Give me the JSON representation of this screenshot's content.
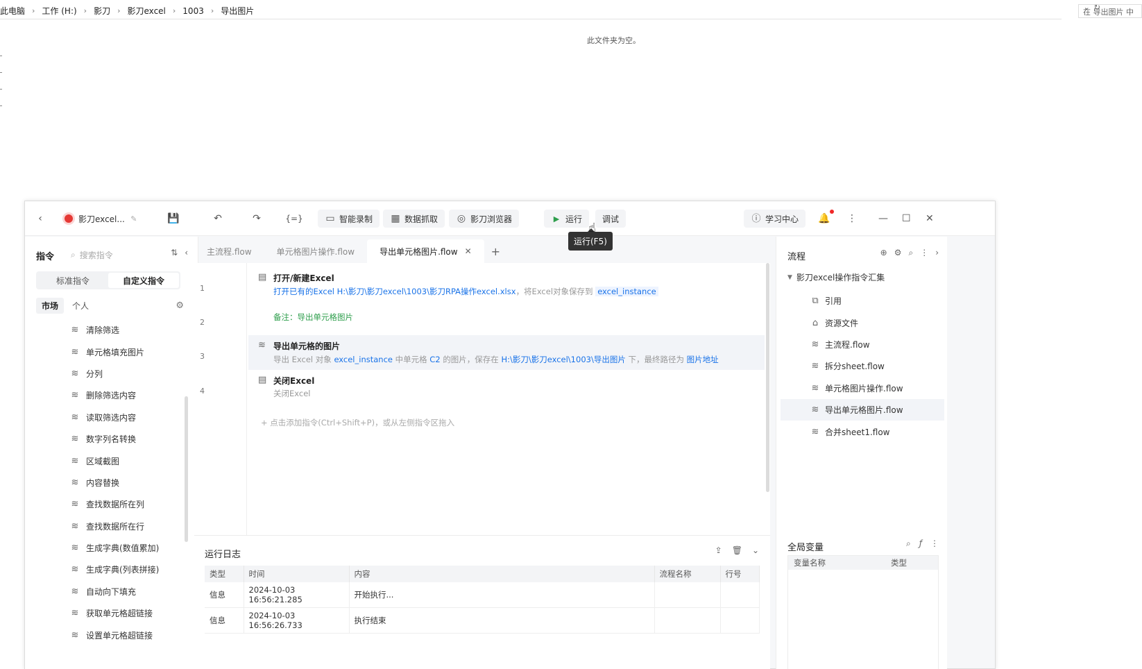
{
  "explorer": {
    "breadcrumb": [
      "此电脑",
      "工作 (H:)",
      "影刀",
      "影刀excel",
      "1003",
      "导出图片"
    ],
    "search_placeholder": "在 导出图片 中",
    "empty_message": "此文件夹为空。"
  },
  "app": {
    "title": "影刀excel...",
    "toolbar": {
      "record": "智能录制",
      "capture": "数据抓取",
      "browser": "影刀浏览器",
      "run": "运行",
      "debug": "调试",
      "learn": "学习中心",
      "run_tooltip": "运行(F5)"
    },
    "left": {
      "title": "指令",
      "search_placeholder": "搜索指令",
      "seg_standard": "标准指令",
      "seg_custom": "自定义指令",
      "market": "市场",
      "personal": "个人",
      "commands": [
        "清除筛选",
        "单元格填充图片",
        "分列",
        "删除筛选内容",
        "读取筛选内容",
        "数字列名转换",
        "区域截图",
        "内容替换",
        "查找数据所在列",
        "查找数据所在行",
        "生成字典(数值累加)",
        "生成字典(列表拼接)",
        "自动向下填充",
        "获取单元格超链接",
        "设置单元格超链接"
      ]
    },
    "tabs": [
      "主流程.flow",
      "单元格图片操作.flow",
      "导出单元格图片.flow"
    ],
    "steps": {
      "s1": {
        "num": "1",
        "title": "打开/新建Excel",
        "desc_a": "打开已有的Excel H:\\影刀\\影刀excel\\1003\\影刀RPA操作excel.xlsx",
        "desc_b": "，将Excel对象保存到",
        "var": "excel_instance"
      },
      "s2": {
        "num": "2",
        "note": "备注：导出单元格图片"
      },
      "s3": {
        "num": "3",
        "title": "导出单元格的图片",
        "p1": "导出 Excel 对象",
        "v1": "excel_instance",
        "p2": "中单元格",
        "v2": "C2",
        "p3": "的图片，保存在",
        "v3": "H:\\影刀\\影刀excel\\1003\\导出图片",
        "p4": "下，最终路径为",
        "v4": "图片地址"
      },
      "s4": {
        "num": "4",
        "title": "关闭Excel",
        "desc": "关闭Excel"
      },
      "add_hint": "点击添加指令(Ctrl+Shift+P)，或从左侧指令区拖入"
    },
    "log": {
      "title": "运行日志",
      "columns": [
        "类型",
        "时间",
        "内容",
        "流程名称",
        "行号"
      ],
      "rows": [
        [
          "信息",
          "2024-10-03 16:56:21.285",
          "开始执行...",
          "",
          ""
        ],
        [
          "信息",
          "2024-10-03 16:56:26.733",
          "执行结束",
          "",
          ""
        ]
      ]
    },
    "right": {
      "title": "流程",
      "root": "影刀excel操作指令汇集",
      "items": [
        "引用",
        "资源文件",
        "主流程.flow",
        "拆分sheet.flow",
        "单元格图片操作.flow",
        "导出单元格图片.flow",
        "合并sheet1.flow"
      ],
      "gv_title": "全局变量",
      "gv_col_name": "变量名称",
      "gv_col_type": "类型"
    }
  }
}
